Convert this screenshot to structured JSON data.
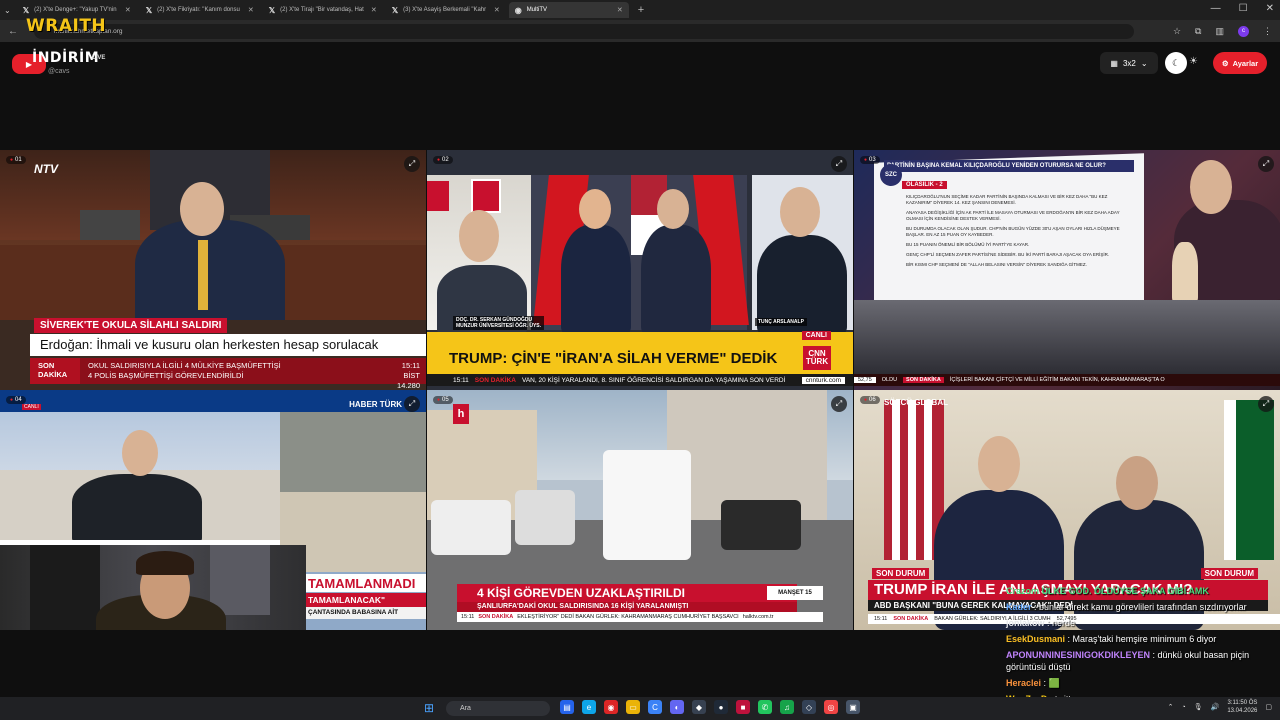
{
  "browser": {
    "tabs": [
      {
        "label": "(2) X'te Denge+: \"Yakup TV'nin",
        "active": false
      },
      {
        "label": "(2) X'te Fikriyatı: \"Kanım donsu",
        "active": false
      },
      {
        "label": "(2) X'te Tirajı \"Bir vatandaş, Hat",
        "active": false
      },
      {
        "label": "(3) X'te Asayiş Berkemali \"Kahr",
        "active": false
      },
      {
        "label": "MultiTV",
        "active": true
      }
    ],
    "url": "multitv.ahmetkaplan.org",
    "profile_initial": "c"
  },
  "overlay": {
    "wraith": "WRAITH"
  },
  "header": {
    "channel_name": "İNDİRİM",
    "live_label": "LIVE",
    "handle": "@cavs",
    "grid_label": "3x2",
    "settings_label": "Ayarlar"
  },
  "cells": [
    {
      "num": "01",
      "logo": "NTV",
      "tag": "SİVEREK'TE OKULA SİLAHLI SALDIRI",
      "headline": "Erdoğan: İhmali ve kusuru olan herkesten hesap sorulacak",
      "ticker_label_1": "SON",
      "ticker_label_2": "DAKİKA",
      "ticker_line_1": "OKUL SALDIRISIYLA İLGİLİ 4 MÜLKİYE BAŞMÜFETTİŞİ",
      "ticker_line_2": "4 POLİS BAŞMÜFETTİŞİ GÖREVLENDİRİLDİ",
      "time": "15:11",
      "bist": "BİST 14.280"
    },
    {
      "num": "02",
      "guest_caption_1": "DOÇ. DR. SERKAN GÜNDOĞDU",
      "guest_caption_2": "MUNZUR ÜNİVERSİTESİ ÖĞR. ÜYS.",
      "host_caption": "TUNÇ ARSLANALP",
      "canli": "CANLI",
      "headline": "TRUMP: ÇİN'E \"İRAN'A SİLAH VERME\" DEDİK",
      "logo_top": "CNN",
      "logo_bottom": "TÜRK",
      "time": "15:11",
      "ticker_label": "SON DAKİKA",
      "ticker": "VAN, 20 KİŞİ YARALANDI, 8. SINIF ÖĞRENCİSİ SALDIRGAN DA YAŞAMINA SON VERDİ",
      "site": "cnnturk.com"
    },
    {
      "num": "03",
      "logo": "SZC",
      "board_title": "PARTİNİN BAŞINA KEMAL KILIÇDAROĞLU YENİDEN OTURURSA NE OLUR?",
      "board_sub": "OLASILIK - 2",
      "board_items": [
        "KILIÇDAROĞLU'NUN SEÇİME KADAR PARTİNİN BAŞINDA KALMASI VE BİR KEZ DAHA \"BU KEZ KAZANIRIM\" DİYEREK 14. KEZ ŞANSINI DENEMESİ.",
        "ANAYASA DEĞİŞİKLİĞİ İÇİN AK PARTİ İLE MASAYA OTURMASI VE ERDOĞAN'IN BİR KEZ DAHA ADAY OLMASI İÇİN KENDİSİNE DESTEK VERMESİ.",
        "BU DURUMDA OLACAK OLAN ŞUDUR. CHP'NİN BUGÜN YÜZDE 30'U AŞAN OYLARI HIZLA DÜŞMEYE BAŞLAR. EN AZ 15 PUAN OY KAYBEDER.",
        "BU 15 PUANIN ÖNEMLİ BİR BÖLÜMÜ İYİ PARTİ'YE KAYAR.",
        "GENÇ CHP'Lİ SEÇMEN ZAFER PARTİSİ'NE SİDEBİR. BU İKİ PARTİ BARAJI AŞACAK OYA ERİŞİR.",
        "BİR KISMI CHP SEÇMENİ DE \"ALLAH BELASINI VERSİN\" DİYEREK SANDIĞA GİTMEZ."
      ],
      "stock": "52,75",
      "ticker_prefix": "OLDU",
      "ticker_label": "SON DAKİKA",
      "ticker": "İÇİŞLERİ BAKANI ÇİFTÇİ VE MİLLİ EĞİTİM BAKANI TEKİN, KAHRAMANMARAŞ'TA O"
    },
    {
      "num": "04",
      "logo": "HABER TÜRK",
      "tag": "CANLI",
      "headline": "TAMAMLANMADI",
      "sub": "TAMAMLANACAK\"",
      "sub2": "ÇANTASINDA BABASINA AİT"
    },
    {
      "num": "05",
      "logo": "h",
      "headline": "4 KİŞİ GÖREVDEN UZAKLAŞTIRILDI",
      "sub": "ŞANLIURFA'DAKİ OKUL SALDIRISINDA 16 KİŞİ YARALANMIŞTI",
      "manset": "MANŞET 15",
      "time": "15:11",
      "ticker_label": "SON DAKİKA",
      "ticker": "EKLEŞTİRİYOR\" DEDİ  BAKAN GÜRLEK: KAHRAMANMARAŞ CUMHURİYET BAŞSAVCI",
      "site": "halktv.com.tr"
    },
    {
      "num": "06",
      "logo": "SÖZCÜ GLOBAL",
      "son_durum": "SON DURUM",
      "headline": "TRUMP İRAN İLE ANLAŞMAYI YAPACAK MI?",
      "sub": "ABD BAŞKANI \"BUNA GEREK KALMAYACAK\" DEDİ",
      "time": "15:11",
      "ticker_label": "SON DAKİKA",
      "ticker": "BAKAN GÜRLEK: SALDIRIYLA İLGİLİ 3 CUMH",
      "stock": "52,7495"
    }
  ],
  "chat": [
    {
      "user": "Crazom",
      "color": "#4ade80",
      "text": "ÜLKE GOD. ÖLDÜYSE ŞAKA GİBİ AMK",
      "pinned": true
    },
    {
      "user": "Kader",
      "color": "#60a5fa",
      "text": "bunlar direkt kamu görevlileri tarafından sızdırıyorlar"
    },
    {
      "user": "jonlakow",
      "color": "#e5e7eb",
      "text": "nerde"
    },
    {
      "user": "EsekDusmani",
      "color": "#fbbf24",
      "text": "Maraş'taki hemşire minimum 6 diyor"
    },
    {
      "user": "APONUNNINESINIGOKDIKLEYEN",
      "color": "#c084fc",
      "text": "dünkü okul basan piçin görüntüsü düştü"
    },
    {
      "user": "Heraclei",
      "color": "#fb923c",
      "text": "🟩"
    },
    {
      "user": "WooZyxD",
      "color": "#facc15",
      "text": "twitter"
    }
  ],
  "taskbar": {
    "search_placeholder": "Ara",
    "time": "3:11:50 ÖS",
    "date": "13.04.2026"
  }
}
